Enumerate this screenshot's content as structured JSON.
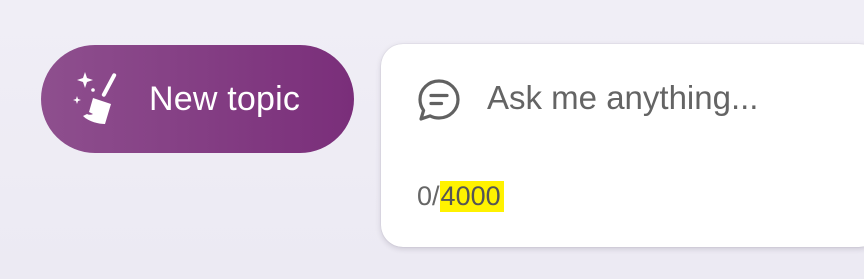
{
  "new_topic_button": {
    "label": "New topic",
    "icon": "broom-sparkle-icon",
    "gradient_start": "#8e4f8e",
    "gradient_end": "#7a2e7a"
  },
  "chat": {
    "icon": "chat-bubble-icon",
    "placeholder": "Ask me anything...",
    "value": "",
    "char_count": "0",
    "separator": "/",
    "char_limit": "4000",
    "highlight_color": "#fff200"
  }
}
